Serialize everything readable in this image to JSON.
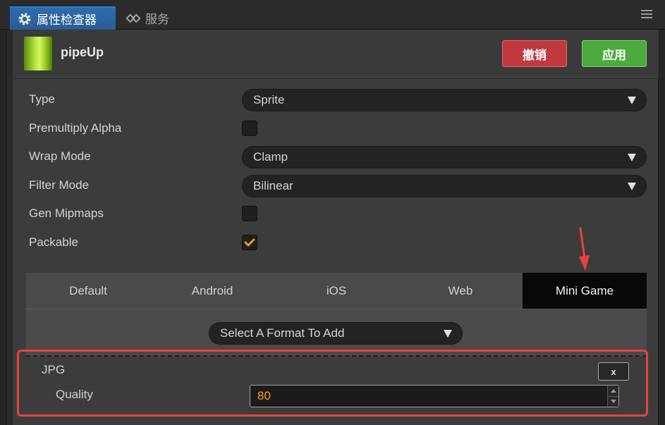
{
  "tabs": {
    "inspector_label": "属性检查器",
    "services_label": "服务"
  },
  "asset": {
    "name": "pipeUp",
    "revert_label": "撤销",
    "apply_label": "应用"
  },
  "properties": {
    "type_label": "Type",
    "type_value": "Sprite",
    "premultiply_label": "Premultiply Alpha",
    "premultiply_checked": false,
    "wrap_label": "Wrap Mode",
    "wrap_value": "Clamp",
    "filter_label": "Filter Mode",
    "filter_value": "Bilinear",
    "mipmaps_label": "Gen Mipmaps",
    "mipmaps_checked": false,
    "packable_label": "Packable",
    "packable_checked": true
  },
  "platforms": {
    "tabs": [
      "Default",
      "Android",
      "iOS",
      "Web",
      "Mini Game"
    ],
    "active": "Mini Game",
    "format_select_placeholder": "Select A Format To Add",
    "format": {
      "name": "JPG",
      "remove_label": "x",
      "quality_label": "Quality",
      "quality_value": "80"
    }
  },
  "colors": {
    "accent": "#f59a23",
    "revert": "#c0393f",
    "apply": "#4caa3e",
    "highlight": "#e8433b"
  }
}
